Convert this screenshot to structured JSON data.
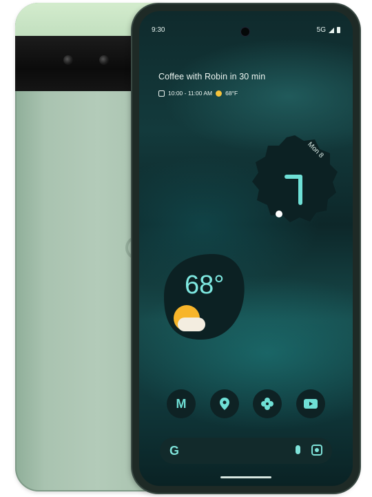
{
  "status_bar": {
    "time": "9:30",
    "network": "5G"
  },
  "glance": {
    "event": "Coffee with Robin in 30 min",
    "time_range": "10:00 - 11:00 AM",
    "temperature": "68°F"
  },
  "clock_widget": {
    "day": "Mon 8"
  },
  "weather_widget": {
    "temperature": "68°"
  },
  "dock": {
    "apps": [
      "gmail-icon",
      "maps-icon",
      "photos-icon",
      "youtube-icon"
    ]
  },
  "search_bar": {
    "logo": "G"
  },
  "colors": {
    "phone_body": "#b3cbb9",
    "accent": "#7ee8e0",
    "sun": "#f7b52a"
  }
}
